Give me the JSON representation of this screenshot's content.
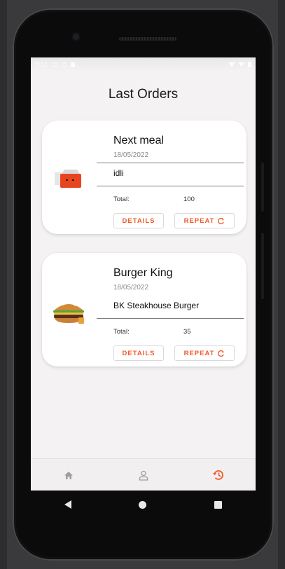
{
  "status_bar": {
    "time": "5:11"
  },
  "page": {
    "title": "Last Orders"
  },
  "orders": [
    {
      "restaurant": "Next meal",
      "date": "18/05/2022",
      "item": "idli",
      "total_label": "Total:",
      "total_value": "100",
      "details_label": "DETAILS",
      "repeat_label": "REPEAT",
      "thumbnail_icon": "red-food-bag-icon"
    },
    {
      "restaurant": "Burger King",
      "date": "18/05/2022",
      "item": "BK Steakhouse Burger",
      "total_label": "Total:",
      "total_value": "35",
      "details_label": "DETAILS",
      "repeat_label": "REPEAT",
      "thumbnail_icon": "burger-icon"
    }
  ],
  "bottom_nav": {
    "items": [
      {
        "icon": "home-icon",
        "active": false
      },
      {
        "icon": "profile-icon",
        "active": false
      },
      {
        "icon": "history-icon",
        "active": true
      }
    ]
  },
  "colors": {
    "accent": "#ef5a2a",
    "inactive_icon": "#9e9e9e",
    "screen_bg": "#f4f2f3",
    "card_bg": "#ffffff"
  }
}
